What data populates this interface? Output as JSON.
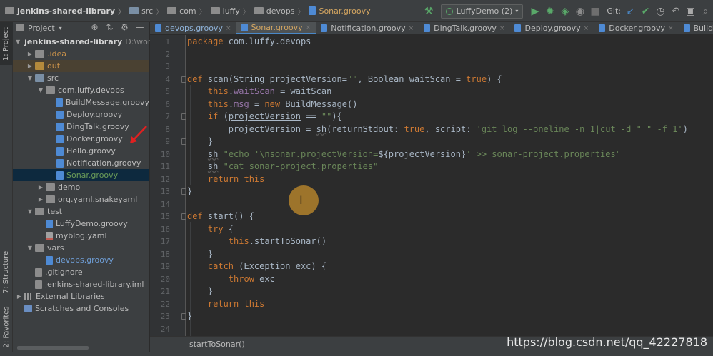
{
  "breadcrumbs": [
    {
      "label": "jenkins-shared-library",
      "kind": "project"
    },
    {
      "label": "src",
      "kind": "folder"
    },
    {
      "label": "com",
      "kind": "folder"
    },
    {
      "label": "luffy",
      "kind": "folder"
    },
    {
      "label": "devops",
      "kind": "folder"
    },
    {
      "label": "Sonar.groovy",
      "kind": "file"
    }
  ],
  "toolbar": {
    "run_config": "LuffyDemo (2)",
    "git_label": "Git:",
    "icons": [
      "hammer-icon",
      "run-icon",
      "debug-icon",
      "coverage-icon",
      "profile-icon",
      "stop-icon",
      "git-update-icon",
      "git-commit-icon",
      "history-icon",
      "revert-icon",
      "project-structure-icon",
      "search-icon"
    ]
  },
  "left_strip": {
    "project_tab": "1: Project",
    "structure_tab": "7: Structure",
    "favorites_tab": "2: Favorites"
  },
  "project_panel": {
    "title": "Project",
    "tree": [
      {
        "label": "jenkins-shared-library",
        "extra": "D:\\workspa",
        "depth": 0,
        "arrow": "▼",
        "icon": "folder",
        "style": "white"
      },
      {
        "label": ".idea",
        "depth": 1,
        "arrow": "▶",
        "icon": "folder",
        "style": "orange"
      },
      {
        "label": "out",
        "depth": 1,
        "arrow": "▶",
        "icon": "folder-orange",
        "style": "orange",
        "highlight": true
      },
      {
        "label": "src",
        "depth": 1,
        "arrow": "▼",
        "icon": "folder-blue",
        "style": ""
      },
      {
        "label": "com.luffy.devops",
        "depth": 2,
        "arrow": "▼",
        "icon": "package",
        "style": ""
      },
      {
        "label": "BuildMessage.groovy",
        "depth": 3,
        "arrow": "",
        "icon": "groovy",
        "style": ""
      },
      {
        "label": "Deploy.groovy",
        "depth": 3,
        "arrow": "",
        "icon": "groovy",
        "style": ""
      },
      {
        "label": "DingTalk.groovy",
        "depth": 3,
        "arrow": "",
        "icon": "groovy",
        "style": ""
      },
      {
        "label": "Docker.groovy",
        "depth": 3,
        "arrow": "",
        "icon": "groovy",
        "style": ""
      },
      {
        "label": "Hello.groovy",
        "depth": 3,
        "arrow": "",
        "icon": "groovy",
        "style": ""
      },
      {
        "label": "Notification.groovy",
        "depth": 3,
        "arrow": "",
        "icon": "groovy",
        "style": ""
      },
      {
        "label": "Sonar.groovy",
        "depth": 3,
        "arrow": "",
        "icon": "groovy",
        "style": "green",
        "selected": true
      },
      {
        "label": "demo",
        "depth": 2,
        "arrow": "▶",
        "icon": "package",
        "style": ""
      },
      {
        "label": "org.yaml.snakeyaml",
        "depth": 2,
        "arrow": "▶",
        "icon": "package",
        "style": ""
      },
      {
        "label": "test",
        "depth": 1,
        "arrow": "▼",
        "icon": "folder",
        "style": ""
      },
      {
        "label": "LuffyDemo.groovy",
        "depth": 2,
        "arrow": "",
        "icon": "groovy",
        "style": ""
      },
      {
        "label": "myblog.yaml",
        "depth": 2,
        "arrow": "",
        "icon": "yaml",
        "style": ""
      },
      {
        "label": "vars",
        "depth": 1,
        "arrow": "▼",
        "icon": "folder",
        "style": ""
      },
      {
        "label": "devops.groovy",
        "depth": 2,
        "arrow": "",
        "icon": "groovy",
        "style": "blue"
      },
      {
        "label": ".gitignore",
        "depth": 1,
        "arrow": "",
        "icon": "file",
        "style": ""
      },
      {
        "label": "jenkins-shared-library.iml",
        "depth": 1,
        "arrow": "",
        "icon": "file",
        "style": ""
      },
      {
        "label": "External Libraries",
        "depth": 0,
        "arrow": "▶",
        "icon": "lib",
        "style": ""
      },
      {
        "label": "Scratches and Consoles",
        "depth": 0,
        "arrow": "",
        "icon": "scratch",
        "style": ""
      }
    ]
  },
  "tabs": [
    {
      "label": "devops.groovy",
      "active": false,
      "hl": true
    },
    {
      "label": "Sonar.groovy",
      "active": true,
      "hl": false
    },
    {
      "label": "Notification.groovy",
      "active": false,
      "hl": false
    },
    {
      "label": "DingTalk.groovy",
      "active": false,
      "hl": false
    },
    {
      "label": "Deploy.groovy",
      "active": false,
      "hl": false
    },
    {
      "label": "Docker.groovy",
      "active": false,
      "hl": false
    },
    {
      "label": "BuildMessage.grc",
      "active": false,
      "hl": false
    }
  ],
  "code_lines": [
    {
      "n": "1",
      "html": "<span class=\"kw\">package</span> com.luffy.devops"
    },
    {
      "n": "2",
      "html": ""
    },
    {
      "n": "3",
      "html": ""
    },
    {
      "n": "4",
      "html": "<span class=\"kw\">def</span> scan(String <span class=\"ul\">projectVersion</span>=<span class=\"str\">\"\"</span>, Boolean waitScan = <span class=\"kw\">true</span>) {"
    },
    {
      "n": "5",
      "html": "    <span class=\"kw\">this</span>.<span class=\"fld\">waitScan</span> = waitScan"
    },
    {
      "n": "6",
      "html": "    <span class=\"kw\">this</span>.<span class=\"fld\">msg</span> = <span class=\"kw\">new</span> BuildMessage()"
    },
    {
      "n": "7",
      "html": "    <span class=\"kw\">if</span> (<span class=\"ul\">projectVersion</span> == <span class=\"str\">\"\"</span>){"
    },
    {
      "n": "8",
      "html": "        <span class=\"ul\">projectVersion</span> = <span class=\"wavy\">sh</span>(returnStdout: <span class=\"kw\">true</span>, script: <span class=\"str\">'git log --<span class=\"ul\">oneline</span> -n 1|cut -d \" \" -f 1'</span>)"
    },
    {
      "n": "9",
      "html": "    }"
    },
    {
      "n": "10",
      "html": "    <span class=\"wavy\">sh</span> <span class=\"str\">\"echo '\\nsonar.projectVersion=</span>${<span class=\"ul\">projectVersion</span>}<span class=\"str\">' >> sonar-project.properties\"</span>"
    },
    {
      "n": "11",
      "html": "    <span class=\"wavy\">sh</span> <span class=\"str\">\"cat sonar-project.properties\"</span>"
    },
    {
      "n": "12",
      "html": "    <span class=\"kw\">return this</span>"
    },
    {
      "n": "13",
      "html": "}"
    },
    {
      "n": "14",
      "html": ""
    },
    {
      "n": "15",
      "html": "<span class=\"kw\">def</span> start() {"
    },
    {
      "n": "16",
      "html": "    <span class=\"kw\">try</span> {"
    },
    {
      "n": "17",
      "html": "        <span class=\"kw\">this</span>.startToSonar()"
    },
    {
      "n": "18",
      "html": "    }"
    },
    {
      "n": "19",
      "html": "    <span class=\"kw\">catch</span> (Exception exc) {"
    },
    {
      "n": "20",
      "html": "        <span class=\"kw\">throw</span> exc"
    },
    {
      "n": "21",
      "html": "    }"
    },
    {
      "n": "22",
      "html": "    <span class=\"kw\">return this</span>"
    },
    {
      "n": "23",
      "html": "}"
    },
    {
      "n": "24",
      "html": ""
    }
  ],
  "bottom_breadcrumb": "startToSonar()",
  "watermark": "https://blog.csdn.net/qq_42227818",
  "colors": {
    "keyword": "#cc7832",
    "string": "#6a8759",
    "field": "#9876aa",
    "selection": "#0d293e"
  }
}
